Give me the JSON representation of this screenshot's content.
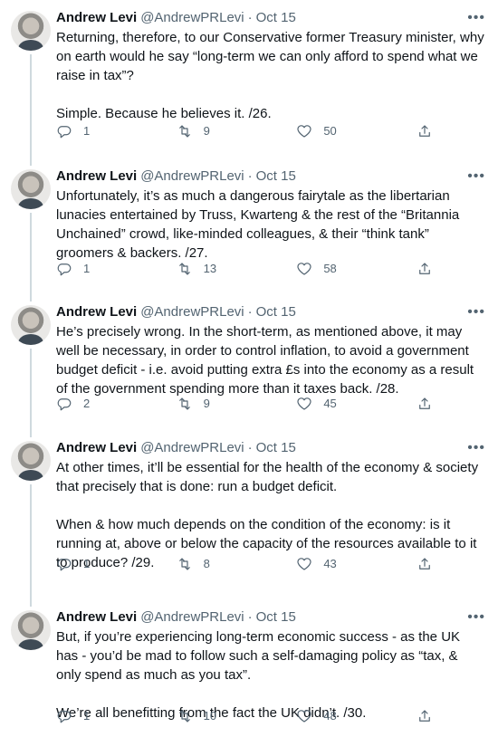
{
  "tweets": [
    {
      "name": "Andrew Levi",
      "handle": "@AndrewPRLevi",
      "date": "Oct 15",
      "text": "Returning, therefore, to our Conservative former Treasury minister, why on earth would he say “long-term we can only afford to spend what we raise in tax”?\n\nSimple. Because he believes it. /26.",
      "replies": "1",
      "retweets": "9",
      "likes": "50"
    },
    {
      "name": "Andrew Levi",
      "handle": "@AndrewPRLevi",
      "date": "Oct 15",
      "text": "Unfortunately, it’s as much a dangerous fairytale as the libertarian lunacies entertained by Truss, Kwarteng & the rest of the “Britannia Unchained” crowd, like-minded colleagues, & their “think tank” groomers & backers. /27.",
      "replies": "1",
      "retweets": "13",
      "likes": "58"
    },
    {
      "name": "Andrew Levi",
      "handle": "@AndrewPRLevi",
      "date": "Oct 15",
      "text": "He’s precisely wrong. In the short-term, as mentioned above, it may well be necessary, in order to control inflation, to avoid a government budget deficit - i.e. avoid putting extra £s into the economy as a result of the government spending more than it taxes back. /28.",
      "replies": "2",
      "retweets": "9",
      "likes": "45"
    },
    {
      "name": "Andrew Levi",
      "handle": "@AndrewPRLevi",
      "date": "Oct 15",
      "text": "At other times, it’ll be essential for the health of the economy & society that precisely that is done: run a budget deficit.\n\nWhen & how much depends on the condition of the economy: is it running at, above or below the capacity of the resources available to it to produce? /29.",
      "replies": "1",
      "retweets": "8",
      "likes": "43"
    },
    {
      "name": "Andrew Levi",
      "handle": "@AndrewPRLevi",
      "date": "Oct 15",
      "text": "But, if you’re experiencing long-term economic success - as the UK has - you’d be mad to follow such a self-damaging policy as “tax, & only spend as much as you tax”.\n\nWe’re all benefitting from the fact the UK didn’t. /30.",
      "replies": "1",
      "retweets": "10",
      "likes": "48"
    }
  ],
  "icons": [
    "reply-icon",
    "retweet-icon",
    "like-icon",
    "share-icon",
    "more-icon"
  ],
  "colors": {
    "text": "#0f1419",
    "secondary": "#536471",
    "thread_line": "#cfd9de"
  }
}
